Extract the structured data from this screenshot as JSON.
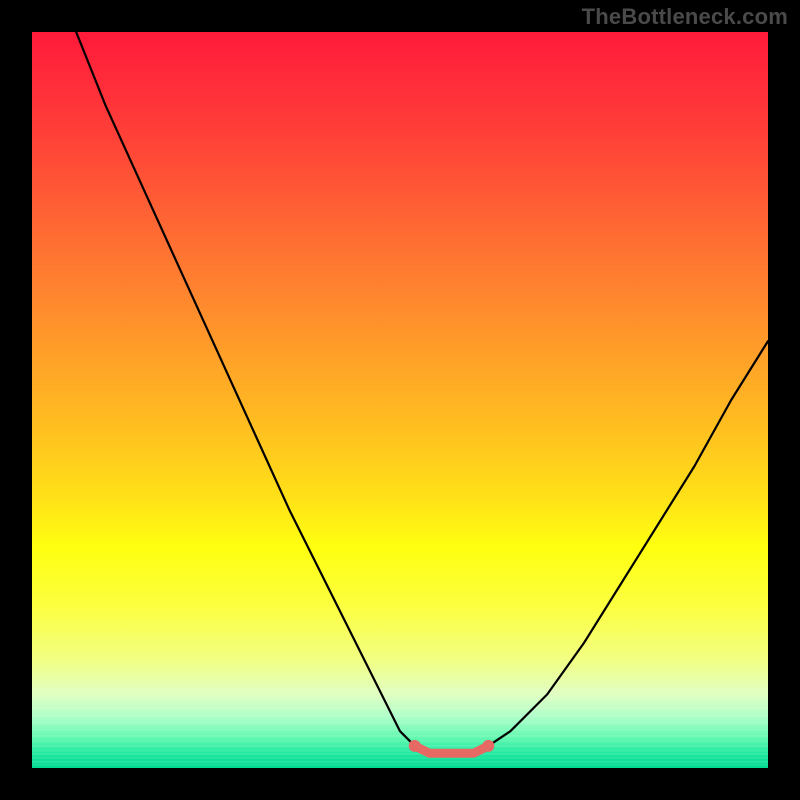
{
  "watermark": "TheBottleneck.com",
  "colors": {
    "page_bg": "#000000",
    "curve": "#000000",
    "marker": "#e66a63",
    "watermark": "#4a4a4a"
  },
  "chart_data": {
    "type": "line",
    "title": "",
    "xlabel": "",
    "ylabel": "",
    "xlim": [
      0,
      100
    ],
    "ylim": [
      0,
      100
    ],
    "grid": false,
    "legend": false,
    "series": [
      {
        "name": "bottleneck-curve",
        "x": [
          6,
          10,
          15,
          20,
          25,
          30,
          35,
          40,
          45,
          48,
          50,
          52,
          55,
          57,
          60,
          62,
          65,
          70,
          75,
          80,
          85,
          90,
          95,
          100
        ],
        "y": [
          100,
          90,
          79,
          68,
          57,
          46,
          35,
          25,
          15,
          9,
          5,
          3,
          2,
          2,
          2,
          3,
          5,
          10,
          17,
          25,
          33,
          41,
          50,
          58
        ]
      },
      {
        "name": "optimal-region",
        "x": [
          52,
          54,
          56,
          58,
          60,
          62
        ],
        "y": [
          3,
          2,
          2,
          2,
          2,
          3
        ]
      }
    ],
    "gradient_stops": [
      {
        "pos": 0,
        "color": "#ff1a3a"
      },
      {
        "pos": 24,
        "color": "#ff6034"
      },
      {
        "pos": 54,
        "color": "#ffc020"
      },
      {
        "pos": 70,
        "color": "#ffff10"
      },
      {
        "pos": 90,
        "color": "#e0ffc2"
      },
      {
        "pos": 100,
        "color": "#00d890"
      }
    ],
    "bottom_bands_y_percent": [
      88,
      89.3,
      90.5,
      91.7,
      92.8,
      93.8,
      94.7,
      95.5,
      96.2,
      96.9,
      97.5,
      98,
      98.5,
      99,
      99.4
    ]
  }
}
